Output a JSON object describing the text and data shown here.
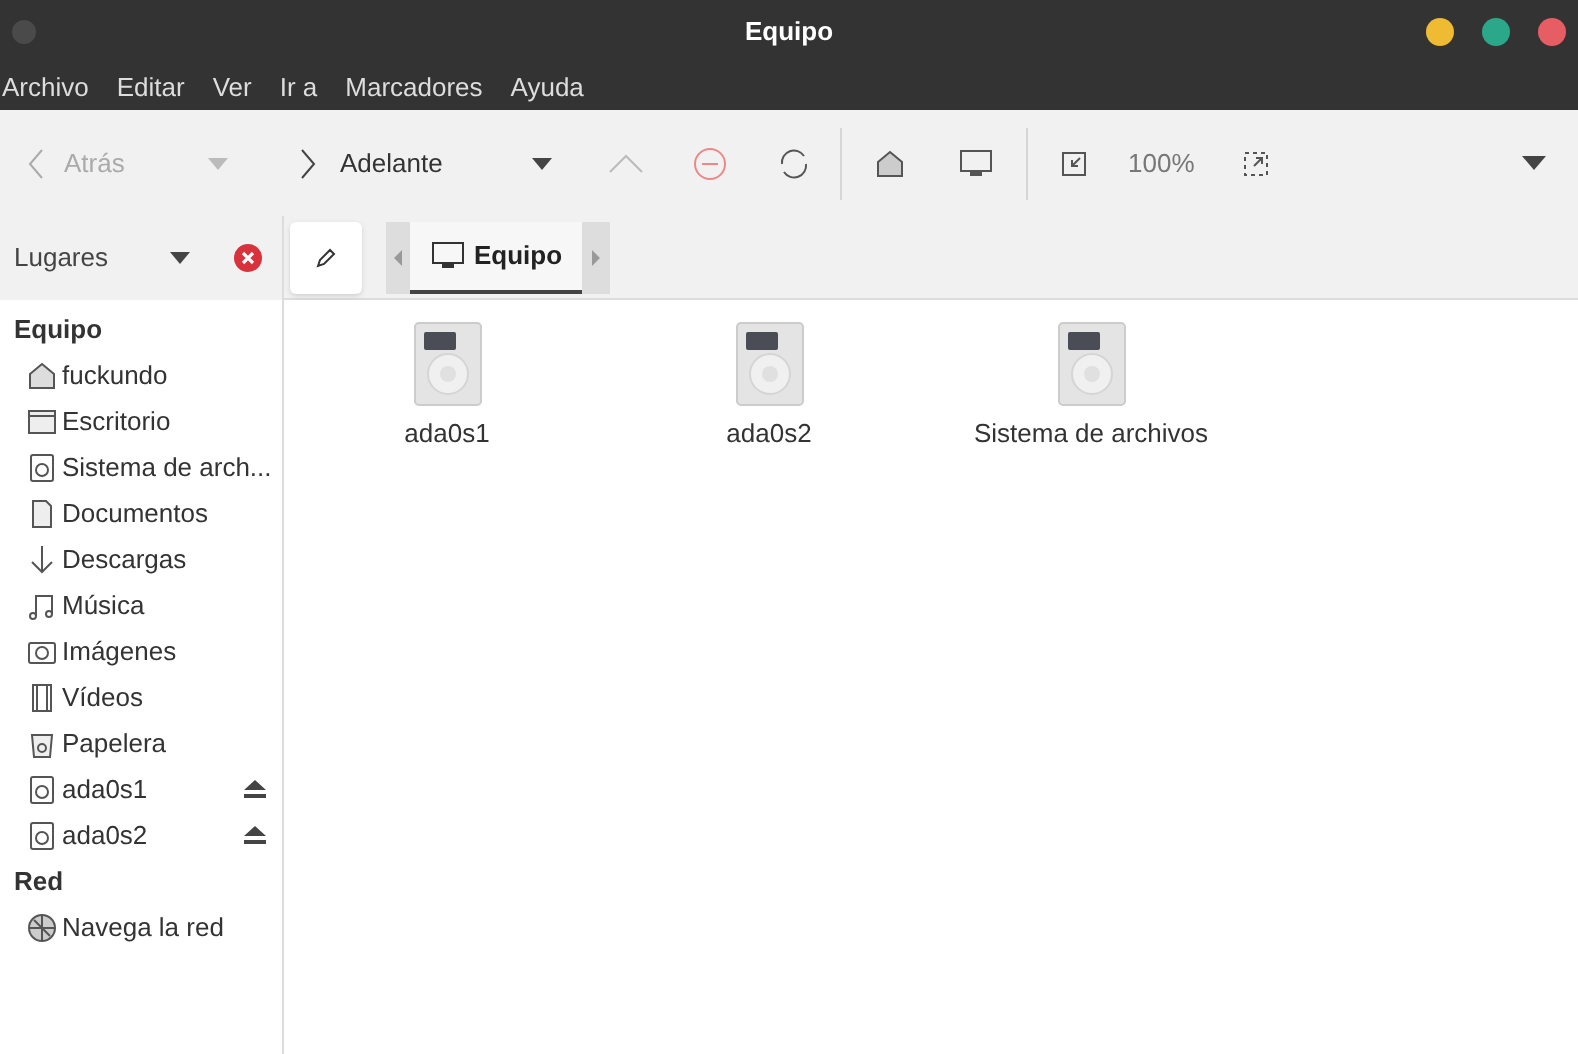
{
  "window": {
    "title": "Equipo"
  },
  "menu": [
    "Archivo",
    "Editar",
    "Ver",
    "Ir a",
    "Marcadores",
    "Ayuda"
  ],
  "toolbar": {
    "back": {
      "label": "Atrás",
      "disabled": true
    },
    "forward": {
      "label": "Adelante",
      "disabled": false
    },
    "up_disabled": true,
    "zoom": "100%"
  },
  "sidebar": {
    "selector": "Lugares",
    "sections": [
      {
        "title": "Equipo",
        "items": [
          {
            "label": "fuckundo"
          },
          {
            "label": "Escritorio"
          },
          {
            "label": "Sistema de arch..."
          },
          {
            "label": "Documentos"
          },
          {
            "label": "Descargas"
          },
          {
            "label": "Música"
          },
          {
            "label": "Imágenes"
          },
          {
            "label": "Vídeos"
          },
          {
            "label": "Papelera"
          },
          {
            "label": "ada0s1",
            "ejectable": true
          },
          {
            "label": "ada0s2",
            "ejectable": true
          }
        ]
      },
      {
        "title": "Red",
        "items": [
          {
            "label": "Navega la red"
          }
        ]
      }
    ]
  },
  "breadcrumb": [
    {
      "label": "Equipo",
      "selected": true
    }
  ],
  "files": [
    {
      "name": "ada0s1"
    },
    {
      "name": "ada0s2"
    },
    {
      "name": "Sistema de archivos"
    }
  ]
}
